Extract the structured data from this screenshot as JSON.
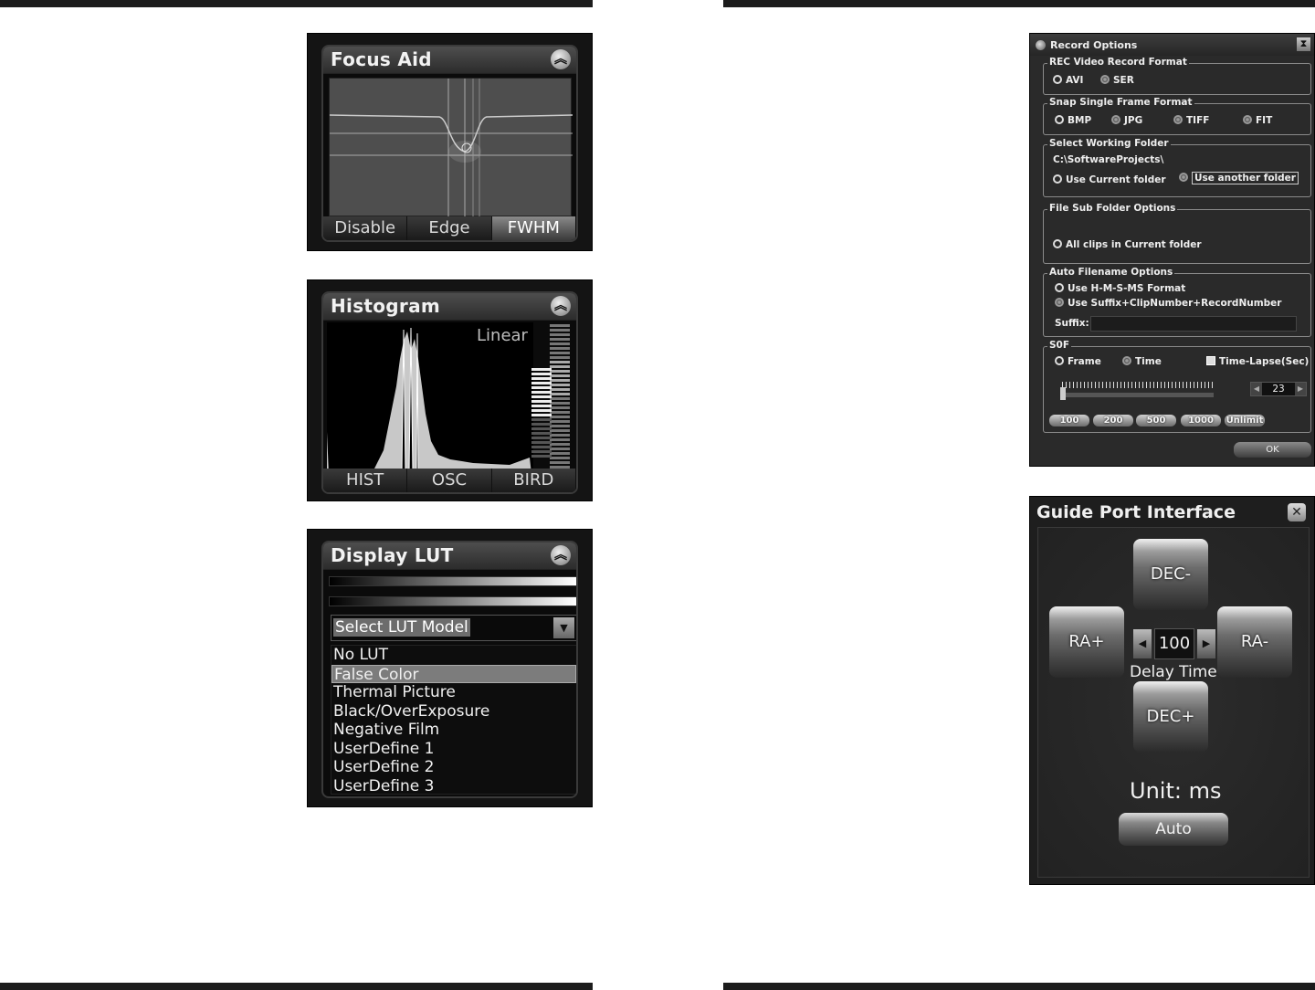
{
  "focus_aid": {
    "title": "Focus Aid",
    "tabs": [
      "Disable",
      "Edge",
      "FWHM"
    ],
    "active_tab": "FWHM"
  },
  "histogram": {
    "title": "Histogram",
    "scale_label": "Linear",
    "tabs": [
      "HIST",
      "OSC",
      "BIRD"
    ]
  },
  "display_lut": {
    "title": "Display LUT",
    "select_label": "Select LUT Model",
    "options": [
      "No LUT",
      "False Color",
      "Thermal Picture",
      "Black/OverExposure",
      "Negative Film",
      "UserDefine 1",
      "UserDefine 2",
      "UserDefine 3"
    ],
    "selected": "False Color"
  },
  "record_options": {
    "title": "Record Options",
    "video_format": {
      "legend": "REC Video Record Format",
      "options": [
        "AVI",
        "SER"
      ]
    },
    "snap_format": {
      "legend": "Snap Single Frame Format",
      "options": [
        "BMP",
        "JPG",
        "TIFF",
        "FIT"
      ]
    },
    "working_folder": {
      "legend": "Select Working Folder",
      "path": "C:\\SoftwareProjects\\",
      "options": [
        "Use Current folder",
        "Use another folder"
      ]
    },
    "sub_folder": {
      "legend": "File Sub Folder Options",
      "option": "All clips in Current folder"
    },
    "auto_filename": {
      "legend": "Auto Filename Options",
      "options": [
        "Use H-M-S-MS Format",
        "Use Suffix+ClipNumber+RecordNumber"
      ],
      "suffix_label": "Suffix:",
      "suffix_value": ""
    },
    "sof": {
      "legend": "S0F",
      "options": [
        "Frame",
        "Time",
        "Time-Lapse(Sec)"
      ],
      "spin_value": "23",
      "quick_buttons": [
        "100",
        "200",
        "500",
        "1000",
        "Unlimit"
      ]
    },
    "ok_label": "OK"
  },
  "guide_port": {
    "title": "Guide Port Interface",
    "dec_minus": "DEC-",
    "dec_plus": "DEC+",
    "ra_plus": "RA+",
    "ra_minus": "RA-",
    "delay_value": "100",
    "delay_label": "Delay Time",
    "unit_label": "Unit: ms",
    "auto_label": "Auto"
  }
}
